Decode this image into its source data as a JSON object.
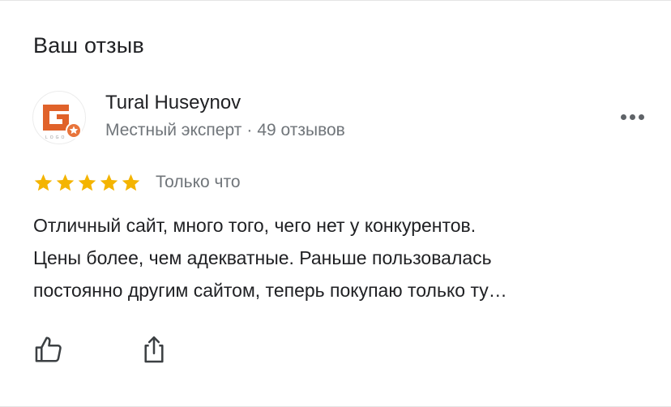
{
  "section": {
    "title": "Ваш отзыв"
  },
  "review": {
    "author": {
      "name": "Tural Huseynov",
      "badge": "Местный эксперт",
      "separator": "·",
      "reviews_count": "49 отзывов",
      "avatar_icon": "company-logo-g-avatar",
      "avatar_logo_letters": "LOGO"
    },
    "rating": {
      "stars": 5,
      "max": 5,
      "star_color": "#f4b400"
    },
    "time": "Только что",
    "text": "Отличный сайт, много того, чего нет у конкурентов.\nЦены более, чем адекватные. Раньше пользовалась\nпостоянно другим сайтом, теперь покупаю только ту…"
  },
  "actions": {
    "more_icon": "more-horizontal-icon",
    "like_icon": "thumbs-up-icon",
    "share_icon": "share-icon"
  },
  "colors": {
    "logo_orange": "#e0622a",
    "local_guide_badge": "#e8743b"
  }
}
